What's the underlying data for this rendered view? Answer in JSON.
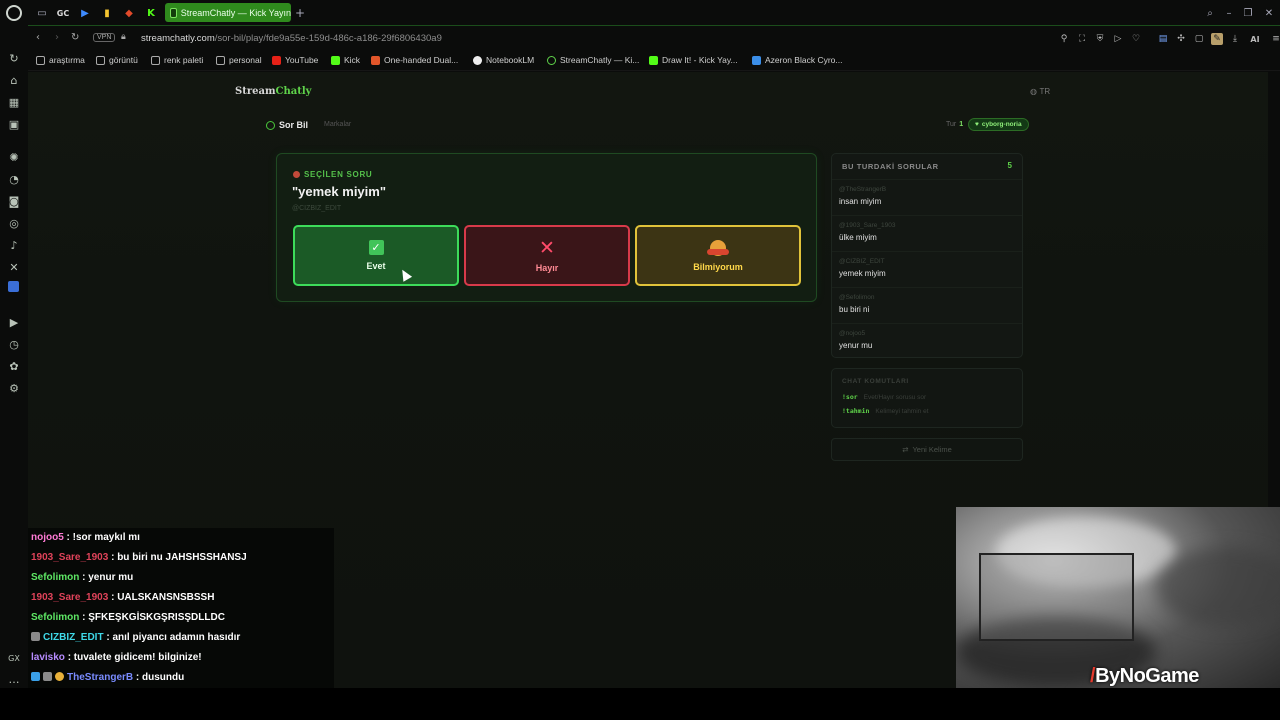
{
  "browser": {
    "tab_title": "StreamChatly — Kick Yayın",
    "tab_gc_label": "GC",
    "url_host": "streamchatly.com",
    "url_path": "/sor-bil/play/fde9a55e-159d-486c-a186-29f6806430a9",
    "vpn_label": "VPN",
    "ai_label": "AI",
    "sidebar_gx_label": "GX",
    "bookmarks": [
      "araştırma",
      "görüntü",
      "renk paleti",
      "personal",
      "YouTube",
      "Kick",
      "One-handed Dual...",
      "NotebookLM",
      "StreamChatly — Ki...",
      "Draw It! - Kick Yay...",
      "Azeron Black Cyro..."
    ]
  },
  "site": {
    "brand_main": "Stream",
    "brand_accent": "Chatly",
    "lang": "TR",
    "game_title": "Sor Bil",
    "leaderboard_link": "Markalar",
    "round_label": "Tur",
    "round_number": "1",
    "user_badge": "cyborg-noria"
  },
  "question": {
    "label": "SEÇİLEN SORU",
    "text": "\"yemek miyim\"",
    "author": "@CIZBIZ_EDIT",
    "answers": {
      "yes": "Evet",
      "no": "Hayır",
      "idk": "Bilmiyorum"
    }
  },
  "round_panel": {
    "header": "BU TURDAKİ SORULAR",
    "count": "5",
    "items": [
      {
        "user": "@TheStrangerB",
        "text": "insan miyim"
      },
      {
        "user": "@1903_Sare_1903",
        "text": "ülke miyim"
      },
      {
        "user": "@CIZBIZ_EDIT",
        "text": "yemek miyim"
      },
      {
        "user": "@Sefolimon",
        "text": "bu biri ni"
      },
      {
        "user": "@nojoo5",
        "text": "yenur mu"
      }
    ]
  },
  "commands": {
    "header": "CHAT KOMUTLARI",
    "items": [
      {
        "cmd": "!sor",
        "desc": "Evet/Hayır sorusu sor"
      },
      {
        "cmd": "!tahmin",
        "desc": "Kelimeyi tahmin et"
      }
    ]
  },
  "new_word_button": "Yeni Kelime",
  "chat": [
    {
      "user": "nojoo5",
      "color": "#ff7bd5",
      "msg": " : !sor maykıl mı"
    },
    {
      "user": "1903_Sare_1903",
      "color": "#e0435a",
      "msg": " : bu biri nu JAHSHSSHANSJ"
    },
    {
      "user": "Sefolimon",
      "color": "#5ee865",
      "msg": " : yenur mu"
    },
    {
      "user": "1903_Sare_1903",
      "color": "#e0435a",
      "msg": " : UALSKANSNSBSSH"
    },
    {
      "user": "Sefolimon",
      "color": "#5ee865",
      "msg": " : ŞFKEŞKGİSKGŞRISŞDLLDC"
    },
    {
      "user": "CIZBIZ_EDIT",
      "color": "#3fd9e8",
      "msg": " : anıl piyancı adamın hasıdır"
    },
    {
      "user": "lavisko",
      "color": "#b78cff",
      "msg": " : tuvalete gidicem! bilginize!"
    },
    {
      "user": "TheStrangerB",
      "color": "#7a8cff",
      "msg": " : dusundu"
    }
  ],
  "cam_logo": "ByNoGame",
  "colors": {
    "accent_green": "#5fd34a",
    "yes_border": "#3ddc5a",
    "no_border": "#d83a4a",
    "idk_border": "#e0c33a",
    "active_tab": "#2f8a1d"
  }
}
